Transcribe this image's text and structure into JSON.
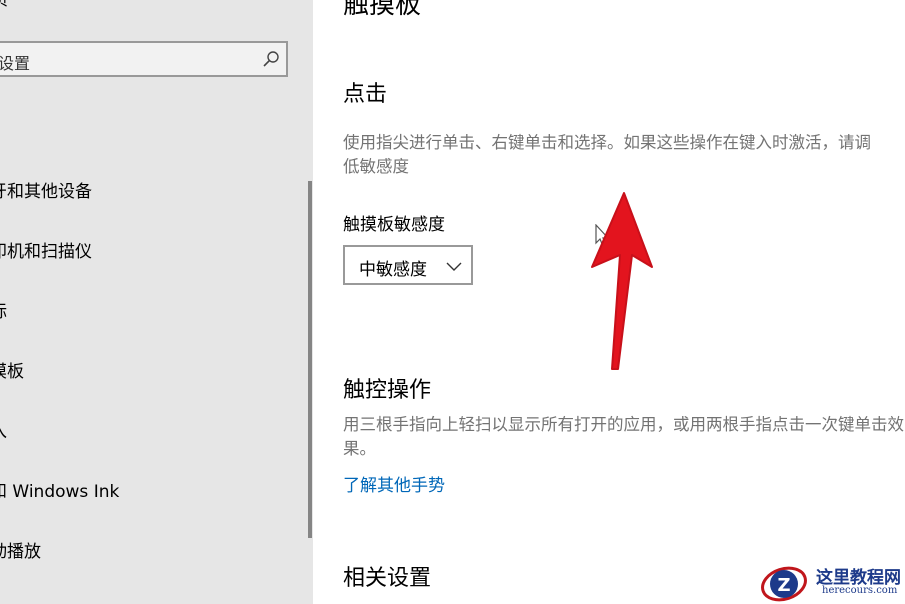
{
  "sidebar": {
    "home_label": "页",
    "search": {
      "placeholder": "设置"
    },
    "items": [
      {
        "label": "牙和其他设备"
      },
      {
        "label": "印机和扫描仪"
      },
      {
        "label": "标"
      },
      {
        "label": "摸板"
      },
      {
        "label": "入"
      },
      {
        "label": "和 Windows Ink"
      },
      {
        "label": "动播放"
      }
    ]
  },
  "main": {
    "page_title": "触摸板",
    "tap_section": {
      "title": "点击",
      "description": "使用指尖进行单击、右键单击和选择。如果这些操作在键入时激活，请调低敏感度",
      "sensitivity_label": "触摸板敏感度",
      "sensitivity_value": "中敏感度"
    },
    "gesture_section": {
      "title": "触控操作",
      "description": "用三根手指向上轻扫以显示所有打开的应用，或用两根手指点击一次键单击效果。",
      "link": "了解其他手势"
    },
    "related_section": {
      "title": "相关设置"
    }
  },
  "watermark": {
    "cn": "这里教程网",
    "en": "herecours.com"
  },
  "colors": {
    "sidebar_bg": "#e6e6e6",
    "link": "#0067b8",
    "arrow": "#e3141e",
    "description": "#737373"
  }
}
